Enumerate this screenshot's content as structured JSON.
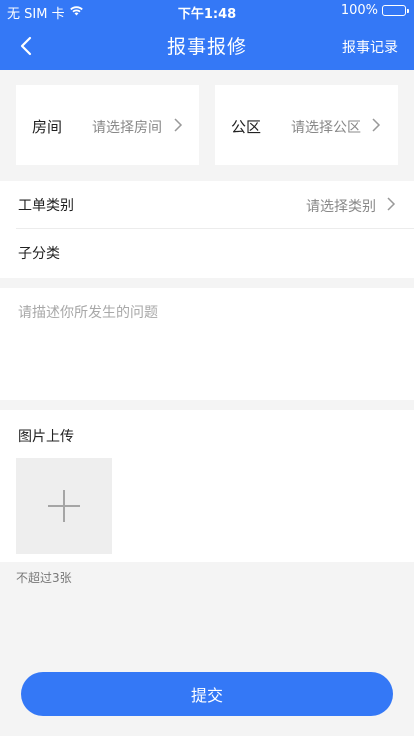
{
  "status_bar": {
    "carrier": "无 SIM 卡",
    "time": "下午1:48",
    "battery": "100%"
  },
  "nav": {
    "title": "报事报修",
    "action": "报事记录"
  },
  "location": {
    "room_label": "房间",
    "room_placeholder": "请选择房间",
    "public_label": "公区",
    "public_placeholder": "请选择公区"
  },
  "category": {
    "label": "工单类别",
    "placeholder": "请选择类别",
    "sub_label": "子分类"
  },
  "description": {
    "placeholder": "请描述你所发生的问题"
  },
  "upload": {
    "title": "图片上传",
    "hint": "不超过3张"
  },
  "submit": {
    "label": "提交"
  },
  "colors": {
    "primary": "#3478f6",
    "background": "#f4f4f4"
  }
}
